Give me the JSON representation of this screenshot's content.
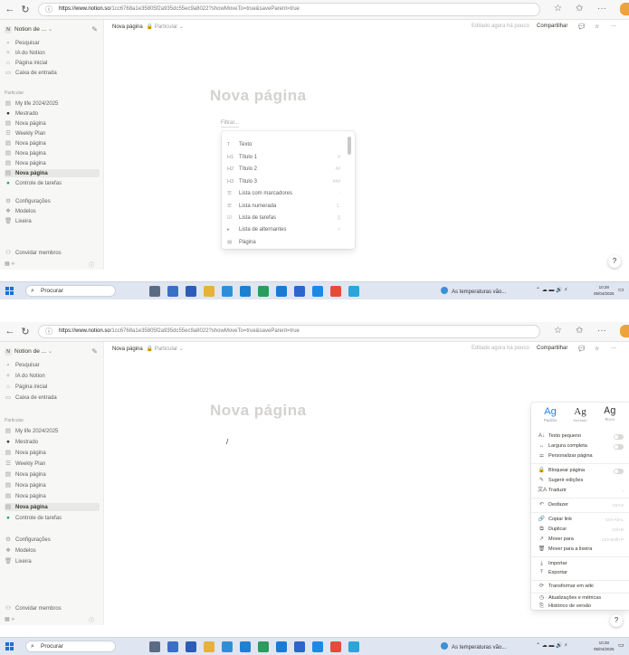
{
  "browser": {
    "url_host": "https://www.notion.so",
    "url_path": "/1cc6768a1e35805f2a935dc55ec9a8022?showMoveTo=true&saveParent=true",
    "back_icon": "arrow-left",
    "reload_icon": "reload"
  },
  "sidebar": {
    "workspace": "Notion de ...",
    "workspace_badge": "N",
    "top_items": [
      {
        "label": "Pesquisar",
        "icon": "⌕"
      },
      {
        "label": "IA do Notion",
        "icon": "✧"
      },
      {
        "label": "Página inicial",
        "icon": "⌂"
      },
      {
        "label": "Caixa de entrada",
        "icon": "▭"
      }
    ],
    "section_label": "Particular",
    "pages": [
      {
        "label": "My life 2024/2025",
        "icon": "▤"
      },
      {
        "label": "Mestrado",
        "icon": "●"
      },
      {
        "label": "Nova página",
        "icon": "▤"
      },
      {
        "label": "Weekly Plan",
        "icon": "☰"
      },
      {
        "label": "Nova página",
        "icon": "▤"
      },
      {
        "label": "Nova página",
        "icon": "▤"
      },
      {
        "label": "Nova página",
        "icon": "▤"
      },
      {
        "label": "Nova página",
        "icon": "▤"
      },
      {
        "label": "Controle de tarefas",
        "icon": "●"
      }
    ],
    "bottom_items": [
      {
        "label": "Configurações",
        "icon": "⚙"
      },
      {
        "label": "Modelos",
        "icon": "❖"
      },
      {
        "label": "Lixeira",
        "icon": "🗑"
      }
    ],
    "invite": "Convidar membros"
  },
  "topbar": {
    "breadcrumb": "Nova página",
    "breadcrumb_sub": "🔒 Particular ⌄",
    "edited": "Editado agora há pouco",
    "share": "Compartilhar",
    "comment_icon": "💬",
    "star_icon": "☆",
    "more_icon": "···"
  },
  "page": {
    "title": "Nova página",
    "filter_placeholder": "Filtrar..."
  },
  "slash_menu": {
    "items": [
      {
        "label": "Texto",
        "icon": "T",
        "shortcut": ""
      },
      {
        "label": "Título 1",
        "icon": "H1",
        "shortcut": "#"
      },
      {
        "label": "Título 2",
        "icon": "H2",
        "shortcut": "##"
      },
      {
        "label": "Título 3",
        "icon": "H3",
        "shortcut": "###"
      },
      {
        "label": "Lista com marcadores",
        "icon": "☰",
        "shortcut": "-"
      },
      {
        "label": "Lista numerada",
        "icon": "☰",
        "shortcut": "1."
      },
      {
        "label": "Lista de tarefas",
        "icon": "☑",
        "shortcut": "[]"
      },
      {
        "label": "Lista de alternantes",
        "icon": "▸",
        "shortcut": ">"
      },
      {
        "label": "Página",
        "icon": "▤",
        "shortcut": ""
      }
    ]
  },
  "more_menu": {
    "fonts": [
      {
        "glyph": "Ag",
        "label": "Padrão"
      },
      {
        "glyph": "Ag",
        "label": "Serifado"
      },
      {
        "glyph": "Ag",
        "label": "Mono"
      }
    ],
    "toggles": [
      {
        "label": "Texto pequeno",
        "icon": "A↓"
      },
      {
        "label": "Largura completa",
        "icon": "↔"
      },
      {
        "label": "Personalizar página",
        "icon": "⚌"
      }
    ],
    "group2": [
      {
        "label": "Bloquear página",
        "icon": "🔒",
        "shortcut": ""
      },
      {
        "label": "Sugerir edições",
        "icon": "✎",
        "shortcut": ""
      },
      {
        "label": "Traduzir",
        "icon": "文A",
        "shortcut": "›"
      }
    ],
    "group3": [
      {
        "label": "Desfazer",
        "icon": "↶",
        "shortcut": "Ctrl+Z"
      }
    ],
    "group4": [
      {
        "label": "Copiar link",
        "icon": "🔗",
        "shortcut": "Ctrl+Alt+L"
      },
      {
        "label": "Duplicar",
        "icon": "⧉",
        "shortcut": "Ctrl+D"
      },
      {
        "label": "Mover para",
        "icon": "↗",
        "shortcut": "Ctrl+Shift+P"
      },
      {
        "label": "Mover para a lixeira",
        "icon": "🗑",
        "shortcut": ""
      }
    ],
    "group5": [
      {
        "label": "Importar",
        "icon": "⤓"
      },
      {
        "label": "Exportar",
        "icon": "⤒"
      }
    ],
    "group6": [
      {
        "label": "Transformar em wiki",
        "icon": "⟳"
      }
    ],
    "group7": [
      {
        "label": "Atualizações e métricas",
        "icon": "◷"
      },
      {
        "label": "Histórico de versão",
        "icon": "⎘"
      }
    ]
  },
  "taskbar": {
    "search": "Procurar",
    "weather": "As temperaturas vão...",
    "time": "10:28",
    "date": "05/04/2025"
  },
  "colors": {
    "accent": "#2383e2",
    "sidebar_bg": "#f7f7f5",
    "taskbar_bg": "#dfe6f1",
    "grammarly": "#15c39a"
  }
}
